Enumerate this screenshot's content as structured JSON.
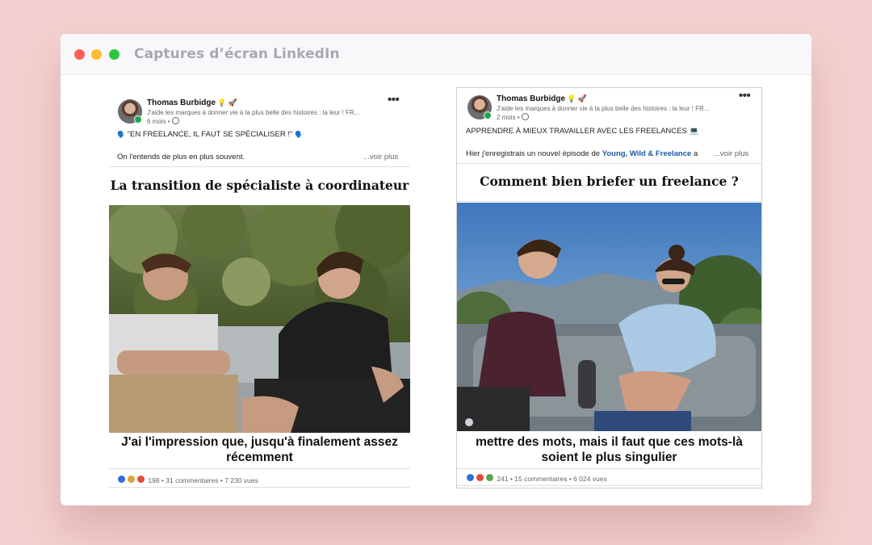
{
  "window": {
    "title": "Captures d’écran LinkedIn"
  },
  "posts": [
    {
      "author": "Thomas Burbidge",
      "author_emoji": "💡 🚀",
      "headline": "J'aide les marques à donner vie à la plus belle des histoires : la leur ! FR...",
      "time": "6 mois •",
      "text_line1": "\"EN FREELANCE, IL FAUT SE SPÉCIALISER !\"",
      "text_line2": "On l'entends de plus en plus souvent.",
      "see_more": "...voir plus",
      "video_title": "La transition de spécialiste à coordinateur",
      "caption": "J'ai l'impression que, jusqu'à finalement assez récemment",
      "reactions": "198",
      "comments": "31 commentaires",
      "views": "7 230 vues"
    },
    {
      "author": "Thomas Burbidge",
      "author_emoji": "💡 🚀",
      "headline": "J'aide les marques à donner vie à la plus belle des histoires : la leur ! FR...",
      "time": "2 mois •",
      "text_line1": "APPRENDRE À MIEUX TRAVAILLER AVEC LES FREELANCES 💻",
      "text_line2_prefix": "Hier j'enregistrais un nouvel épisode de",
      "text_line2_link": "Young, Wild & Freelance",
      "text_line2_suffix": "a",
      "see_more": "...voir plus",
      "video_title": "Comment bien briefer un freelance ?",
      "caption": "mettre des mots, mais il faut que ces mots-là soient le plus singulier",
      "reactions": "241",
      "comments": "15 commentaires",
      "views": "6 024 vues"
    }
  ],
  "icons": {
    "more": "more-options-icon",
    "globe": "globe-icon",
    "reactions": [
      "like-icon",
      "celebrate-icon",
      "love-icon"
    ]
  },
  "colors": {
    "background": "#f3d0cf",
    "linkedin_link": "#1b5aa6",
    "online": "#1fa74a"
  }
}
